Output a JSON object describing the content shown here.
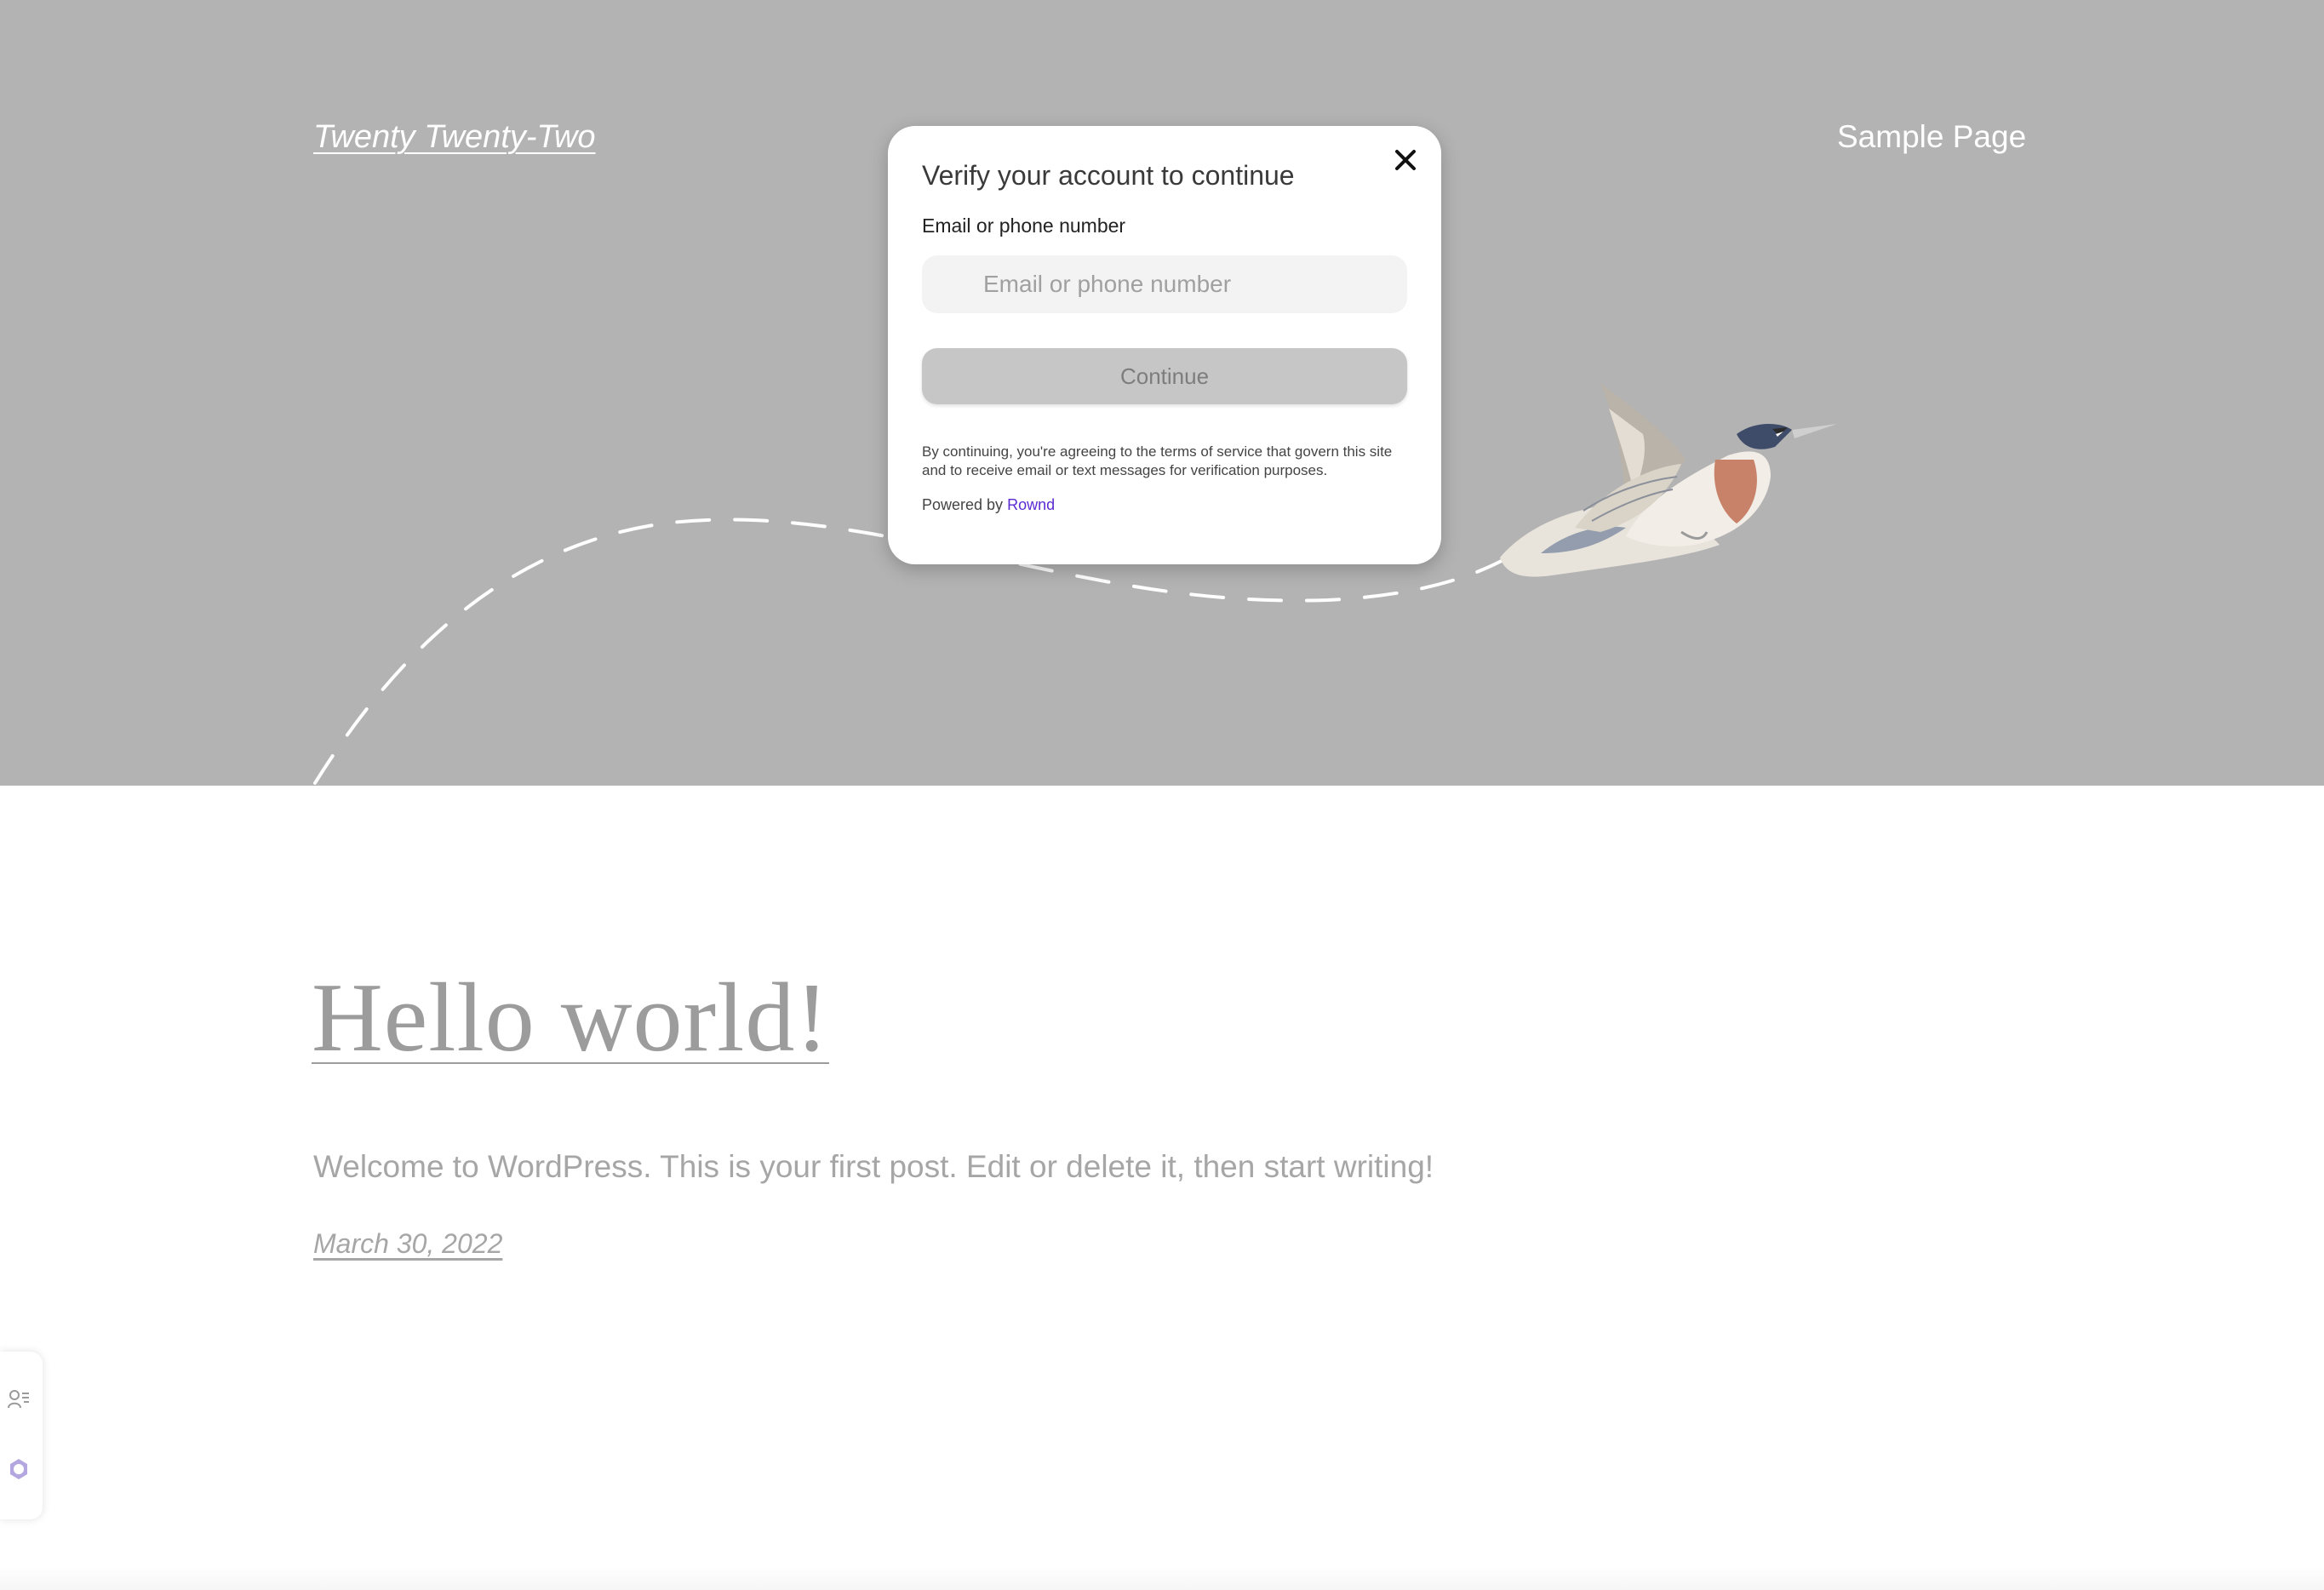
{
  "header": {
    "site_title": "Twenty Twenty-Two",
    "nav": [
      {
        "label": "Sample Page"
      }
    ]
  },
  "post": {
    "title": "Hello world!",
    "excerpt": "Welcome to WordPress. This is your first post. Edit or delete it, then start writing!",
    "date": "March 30, 2022"
  },
  "modal": {
    "title": "Verify your account to continue",
    "field_label": "Email or phone number",
    "field_placeholder": "Email or phone number",
    "field_value": "",
    "continue_label": "Continue",
    "legal_text": "By continuing, you're agreeing to the terms of service that govern this site and to receive email or text messages for verification purposes.",
    "powered_by_prefix": "Powered by",
    "powered_by_link": "Rownd"
  },
  "side_widget": {
    "icons": [
      "user-list-icon",
      "rownd-logo-icon"
    ]
  },
  "icons": {
    "close": "close-icon",
    "hero_art": "bird-illustration-icon"
  },
  "colors": {
    "hero_background": "#b3b3b3",
    "link_accent": "#5b2bd1",
    "button_disabled": "#c6c6c6"
  }
}
